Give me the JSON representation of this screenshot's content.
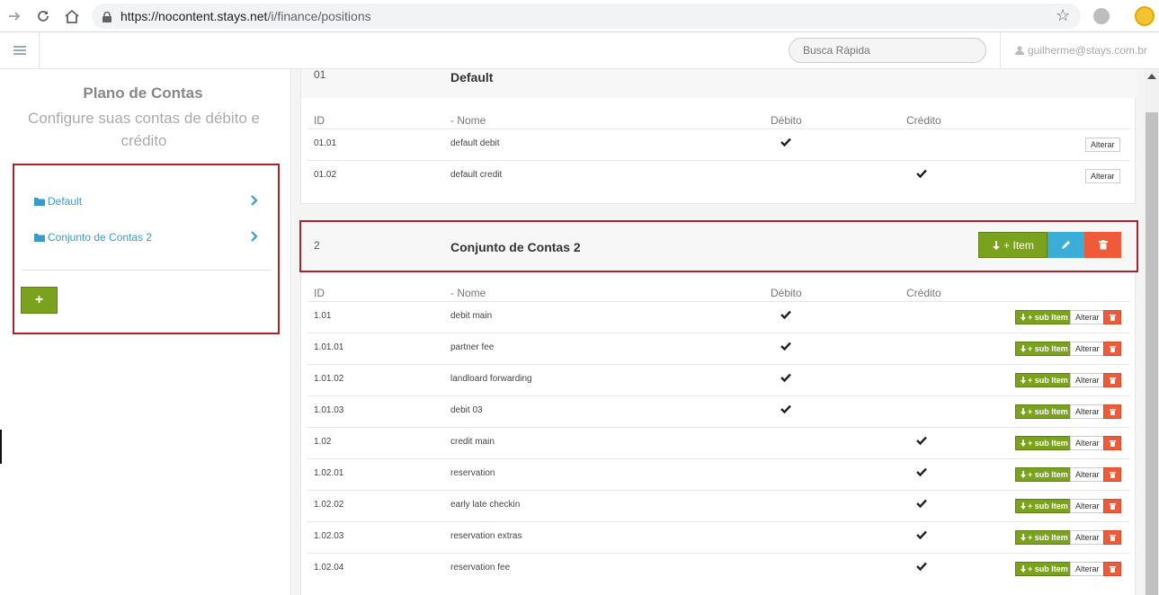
{
  "browser": {
    "url_host": "https://nocontent.stays.net",
    "url_path": "/i/finance/positions"
  },
  "header": {
    "search_placeholder": "Busca Rápida",
    "user_email": "guilherme@stays.com.br"
  },
  "sidebar": {
    "title": "Plano de Contas",
    "subtitle": "Configure suas contas de débito e crédito",
    "items": [
      {
        "label": "Default"
      },
      {
        "label": "Conjunto de Contas 2"
      }
    ],
    "add_label": "+"
  },
  "columns": {
    "id": "ID",
    "name": "- Nome",
    "debit": "Débito",
    "credit": "Crédito"
  },
  "sets": [
    {
      "id": "01",
      "name": "Default",
      "rows": [
        {
          "id": "01.01",
          "name": "default debit",
          "debit": true,
          "credit": false
        },
        {
          "id": "01.02",
          "name": "default credit",
          "debit": false,
          "credit": true
        }
      ]
    },
    {
      "id": "2",
      "name": "Conjunto de Contas 2",
      "rows": [
        {
          "id": "1.01",
          "name": "debit main",
          "debit": true,
          "credit": false
        },
        {
          "id": "1.01.01",
          "name": "partner fee",
          "debit": true,
          "credit": false
        },
        {
          "id": "1.01.02",
          "name": "landloard forwarding",
          "debit": true,
          "credit": false
        },
        {
          "id": "1.01.03",
          "name": "debit 03",
          "debit": true,
          "credit": false
        },
        {
          "id": "1.02",
          "name": "credit main",
          "debit": false,
          "credit": true
        },
        {
          "id": "1.02.01",
          "name": "reservation",
          "debit": false,
          "credit": true
        },
        {
          "id": "1.02.02",
          "name": "early late checkin",
          "debit": false,
          "credit": true
        },
        {
          "id": "1.02.03",
          "name": "reservation extras",
          "debit": false,
          "credit": true
        },
        {
          "id": "1.02.04",
          "name": "reservation fee",
          "debit": false,
          "credit": true
        }
      ]
    }
  ],
  "buttons": {
    "alterar": "Alterar",
    "add_item": "+ Item",
    "add_sub_item": "+ sub Item"
  },
  "colors": {
    "green": "#7aa21d",
    "blue": "#3aaed8",
    "red": "#ef5b38",
    "highlight_border": "#a8232a",
    "link": "#3a9bc6"
  }
}
